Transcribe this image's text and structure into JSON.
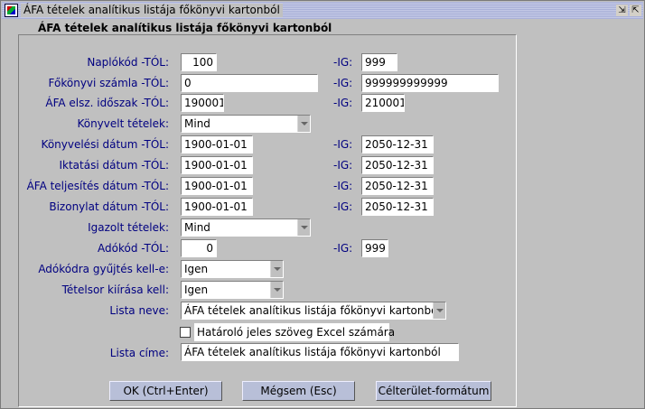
{
  "window": {
    "title": "ÁFA tételek analítikus listája főkönyvi kartonból"
  },
  "panel": {
    "title": "ÁFA tételek analítikus listája főkönyvi kartonból"
  },
  "ig_label": "-IG:",
  "fields": {
    "naplokod": {
      "label": "Naplókód -TÓL:",
      "from": "100",
      "to": "999"
    },
    "fokonyv": {
      "label": "Főkönyvi számla -TÓL:",
      "from": "0",
      "to": "999999999999"
    },
    "afa_idoszak": {
      "label": "ÁFA elsz. időszak -TÓL:",
      "from": "190001",
      "to": "210001"
    },
    "konyvelt": {
      "label": "Könyvelt tételek:",
      "value": "Mind"
    },
    "konyv_datum": {
      "label": "Könyvelési dátum -TÓL:",
      "from": "1900-01-01",
      "to": "2050-12-31"
    },
    "iktatas": {
      "label": "Iktatási dátum -TÓL:",
      "from": "1900-01-01",
      "to": "2050-12-31"
    },
    "teljesites": {
      "label": "ÁFA teljesítés dátum -TÓL:",
      "from": "1900-01-01",
      "to": "2050-12-31"
    },
    "bizonylat": {
      "label": "Bizonylat dátum -TÓL:",
      "from": "1900-01-01",
      "to": "2050-12-31"
    },
    "igazolt": {
      "label": "Igazolt tételek:",
      "value": "Mind"
    },
    "adokod": {
      "label": "Adókód -TÓL:",
      "from": "0",
      "to": "999"
    },
    "gyujtes": {
      "label": "Adókódra gyűjtés kell-e:",
      "value": "Igen"
    },
    "tetelsor": {
      "label": "Tételsor kiírása kell:",
      "value": "Igen"
    },
    "lista_neve": {
      "label": "Lista neve:",
      "value": "ÁFA tételek analítikus listája főkönyvi kartonból"
    },
    "hatarolo": {
      "label": "Határoló jeles szöveg  Excel számára",
      "checked": false
    },
    "lista_cime": {
      "label": "Lista címe:",
      "value": "ÁFA tételek analítikus listája főkönyvi kartonból"
    }
  },
  "buttons": {
    "ok": "OK (Ctrl+Enter)",
    "cancel": "Mégsem (Esc)",
    "format": "Célterület-formátum"
  }
}
